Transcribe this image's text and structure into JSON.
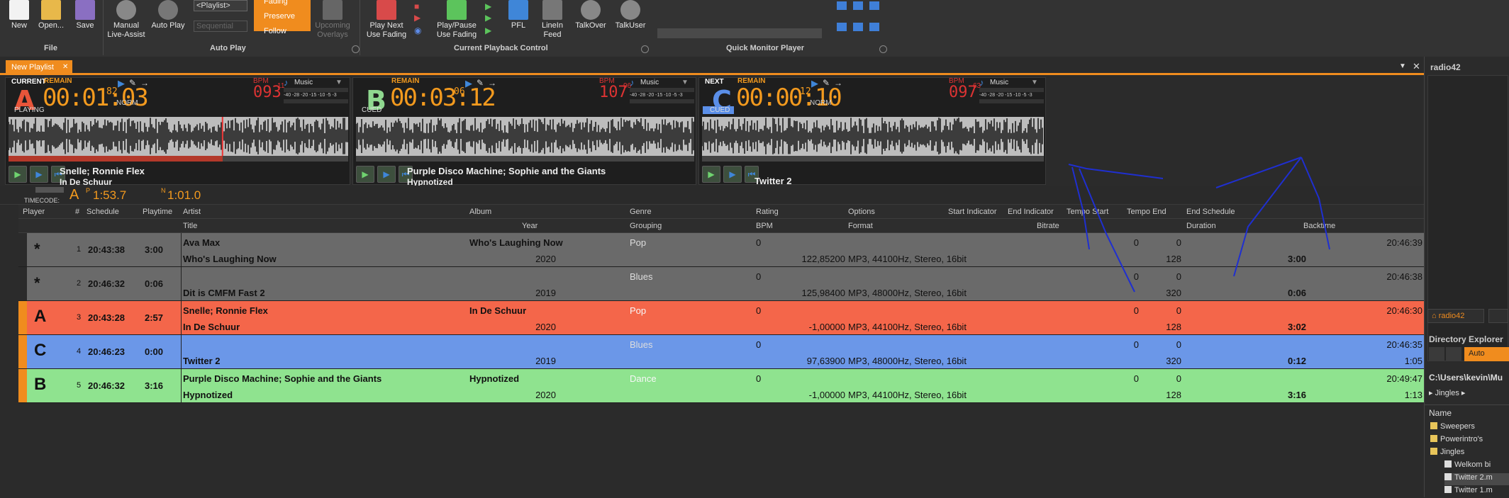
{
  "ribbon": {
    "new": "New",
    "open": "Open...",
    "save": "Save",
    "manual": "Manual",
    "live_assist": "Live-Assist",
    "auto_play": "Auto Play",
    "playlist_select": "<Playlist>",
    "sequential": "Sequential",
    "fading": "Fading",
    "preserve": "Preserve",
    "follow": "Follow",
    "upcoming": "Upcoming",
    "overlays": "Overlays",
    "play_next": "Play Next",
    "use_fading": "Use Fading",
    "play_pause": "Play/Pause",
    "use_fading2": "Use Fading",
    "pfl": "PFL",
    "linein": "LineIn",
    "feed": "Feed",
    "talkover": "TalkOver",
    "talkuser": "TalkUser",
    "groups": {
      "file": "File",
      "auto_play": "Auto Play",
      "current_playback": "Current Playback Control",
      "quick_monitor": "Quick Monitor Player"
    }
  },
  "tab": {
    "label": "New Playlist",
    "close": "✕"
  },
  "decks": [
    {
      "letter": "A",
      "state_top": "CURRENT",
      "state_bottom": "PLAYING",
      "remain": "REMAIN",
      "time": "00:01:03",
      "frac": "82",
      "mode": "NORM",
      "bpm_label": "BPM",
      "bpm": "093",
      "bpm_frac": "11",
      "music": "Music",
      "artist": "Snelle; Ronnie Flex",
      "title": "In De Schuur",
      "color": "#e8553a",
      "progress": 0.63
    },
    {
      "letter": "B",
      "state_top": "",
      "state_bottom": "CUED",
      "remain": "REMAIN",
      "time": "00:03:12",
      "frac": "06",
      "mode": "",
      "bpm_label": "BPM",
      "bpm": "107",
      "bpm_frac": "96",
      "music": "Music",
      "artist": "Purple Disco Machine; Sophie and the Giants",
      "title": "Hypnotized",
      "color": "#8fd88f",
      "progress": 0
    },
    {
      "letter": "C",
      "state_top": "NEXT",
      "state_bottom": "CUED",
      "remain": "REMAIN",
      "time": "00:00:10",
      "frac": "12",
      "mode": "NORM",
      "bpm_label": "BPM",
      "bpm": "097",
      "bpm_frac": "63",
      "music": "Music",
      "artist": "Twitter 2",
      "title": "",
      "color": "#5b8fe8",
      "progress": 0
    }
  ],
  "meter_scale": "-40 -28 -20 -15 -10 -5 -3",
  "timecode": {
    "label": "TIMECODE:",
    "deck": "A",
    "p_label": "P",
    "p_time": "1:53.7",
    "n_label": "N",
    "n_time": "1:01.0"
  },
  "headers": {
    "player": "Player",
    "num": "#",
    "schedule": "Schedule",
    "playtime": "Playtime",
    "artist": "Artist",
    "title": "Title",
    "album": "Album",
    "year": "Year",
    "genre": "Genre",
    "grouping": "Grouping",
    "rating": "Rating",
    "bpm": "BPM",
    "options": "Options",
    "format": "Format",
    "start_ind": "Start Indicator",
    "end_ind": "End Indicator",
    "bitrate": "Bitrate",
    "tempo_start": "Tempo Start",
    "tempo_end": "Tempo End",
    "end_sched": "End Schedule",
    "duration": "Duration",
    "backtime": "Backtime"
  },
  "rows": [
    {
      "player": "*",
      "num": "1",
      "schedule": "20:43:38",
      "playtime": "3:00",
      "artist": "Ava Max",
      "album": "Who's Laughing Now",
      "genre": "Pop",
      "rating": "0",
      "title": "Who's Laughing Now",
      "year": "2020",
      "bpm": "122,85200",
      "format": "MP3, 44100Hz, Stereo, 16bit",
      "tempo_start": "0",
      "tempo_end": "0",
      "bitrate": "128",
      "duration": "3:00",
      "end_sched": "20:46:39",
      "backtime": "",
      "bg": "#6a6a6a"
    },
    {
      "player": "*",
      "num": "2",
      "schedule": "20:46:32",
      "playtime": "0:06",
      "artist": "",
      "album": "",
      "genre": "Blues",
      "rating": "0",
      "title": "Dit is CMFM Fast 2",
      "year": "2019",
      "bpm": "125,98400",
      "format": "MP3, 48000Hz, Stereo, 16bit",
      "tempo_start": "0",
      "tempo_end": "0",
      "bitrate": "320",
      "duration": "0:06",
      "end_sched": "20:46:38",
      "backtime": "",
      "bg": "#6a6a6a"
    },
    {
      "player": "A",
      "num": "3",
      "schedule": "20:43:28",
      "playtime": "2:57",
      "artist": "Snelle; Ronnie Flex",
      "album": "In De Schuur",
      "genre": "Pop",
      "rating": "0",
      "title": "In De Schuur",
      "year": "2020",
      "bpm": "-1,00000",
      "format": "MP3, 44100Hz, Stereo, 16bit",
      "tempo_start": "0",
      "tempo_end": "0",
      "bitrate": "128",
      "duration": "3:02",
      "end_sched": "20:46:30",
      "backtime": "",
      "bg": "#f4664a"
    },
    {
      "player": "C",
      "num": "4",
      "schedule": "20:46:23",
      "playtime": "0:00",
      "artist": "",
      "album": "",
      "genre": "Blues",
      "rating": "0",
      "title": "Twitter 2",
      "year": "2019",
      "bpm": "97,63900",
      "format": "MP3, 48000Hz, Stereo, 16bit",
      "tempo_start": "0",
      "tempo_end": "0",
      "bitrate": "320",
      "duration": "0:12",
      "end_sched": "20:46:35",
      "backtime": "1:05",
      "bg": "#6b97e8"
    },
    {
      "player": "B",
      "num": "5",
      "schedule": "20:46:32",
      "playtime": "3:16",
      "artist": "Purple Disco Machine; Sophie and the Giants",
      "album": "Hypnotized",
      "genre": "Dance",
      "rating": "0",
      "title": "Hypnotized",
      "year": "2020",
      "bpm": "-1,00000",
      "format": "MP3, 44100Hz, Stereo, 16bit",
      "tempo_start": "0",
      "tempo_end": "0",
      "bitrate": "128",
      "duration": "3:16",
      "end_sched": "20:49:47",
      "backtime": "1:13",
      "bg": "#8fe38f"
    }
  ],
  "side": {
    "title": "radio42",
    "tab1": "radio42",
    "dir_title": "Directory Explorer",
    "auto": "Auto",
    "path": "C:\\Users\\kevin\\Mu",
    "crumb": "Jingles",
    "name_header": "Name",
    "items": [
      "Sweepers",
      "Powerintro's",
      "Jingles",
      "Welkom bi",
      "Twitter 2.m",
      "Twitter 1.m"
    ]
  }
}
